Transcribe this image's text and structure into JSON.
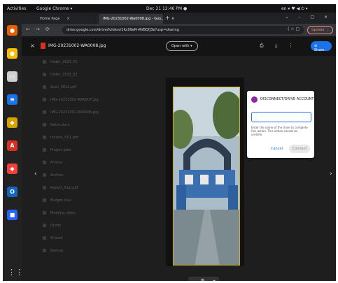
{
  "system_bar": {
    "activities": "Activities",
    "app_menu": "Google Chrome ▾",
    "clock": "Dec 21  12:46 PM ●",
    "indicators": "en ▾   ♥ ◀ ⏻ ▾"
  },
  "dock": {
    "apps": [
      {
        "name": "firefox-icon",
        "glyph": "●",
        "color": "#e66000"
      },
      {
        "name": "chrome-icon",
        "glyph": "●",
        "color": "#fbbc04"
      },
      {
        "name": "files-icon",
        "glyph": "▭",
        "color": "#cfcfcf"
      },
      {
        "name": "document-icon",
        "glyph": "≡",
        "color": "#1a73e8"
      },
      {
        "name": "shield-icon",
        "glyph": "◆",
        "color": "#d7a100"
      },
      {
        "name": "pdf-reader-icon",
        "glyph": "A",
        "color": "#d93025"
      },
      {
        "name": "anydesk-icon",
        "glyph": "◆",
        "color": "#ef443b"
      },
      {
        "name": "circle-app-icon",
        "glyph": "O",
        "color": "#1565c0"
      },
      {
        "name": "remote-app-icon",
        "glyph": "■",
        "color": "#2962ff"
      }
    ],
    "show_apps": "⋮⋮⋮"
  },
  "browser": {
    "tabs": [
      {
        "label": "Home Page",
        "close": "×"
      },
      {
        "label": "IMG-20231002-Wa0008.jpg - Goo...",
        "close": "×"
      }
    ],
    "new_tab": "+",
    "window_controls": "⌄ – ▢ ×",
    "nav": {
      "back": "←",
      "forward": "→",
      "reload": "⟳"
    },
    "url": "drive.google.com/drive/folders/1Kc09ePn4VBQfJ3e?usp=sharing",
    "toolbar_icons": "⟨ ☆   ▢",
    "update_label": "Update ⋮"
  },
  "preview": {
    "close": "×",
    "file_name": "IMG-20231002-WA0008.jpg",
    "open_with": "Open with ▾",
    "icons": "⎙ ⤓ ⋮",
    "share": "⊕ Share",
    "prev": "‹",
    "next": "›",
    "zoom_out": "−",
    "zoom_icon": "🔍",
    "zoom_in": "+"
  },
  "dialog": {
    "title": "DISCONNECT/DRIVE ACCOUNT",
    "input_value": "",
    "help_text": "Enter the name of the drive to complete this action. This action cannot be undone.",
    "cancel": "Cancel",
    "confirm": "Connect"
  },
  "background_rows": [
    "folder_2023_01",
    "folder_2023_02",
    "Scan_0012.pdf",
    "IMG-20231002-WA0007.jpg",
    "IMG-20231002-WA0006.jpg",
    "Notes.docx",
    "Invoice_001.pdf",
    "Project plan",
    "Photos",
    "Archive",
    "Report_final.pdf",
    "Budget.xlsx",
    "Meeting notes",
    "Drafts",
    "Shared",
    "Backup"
  ]
}
